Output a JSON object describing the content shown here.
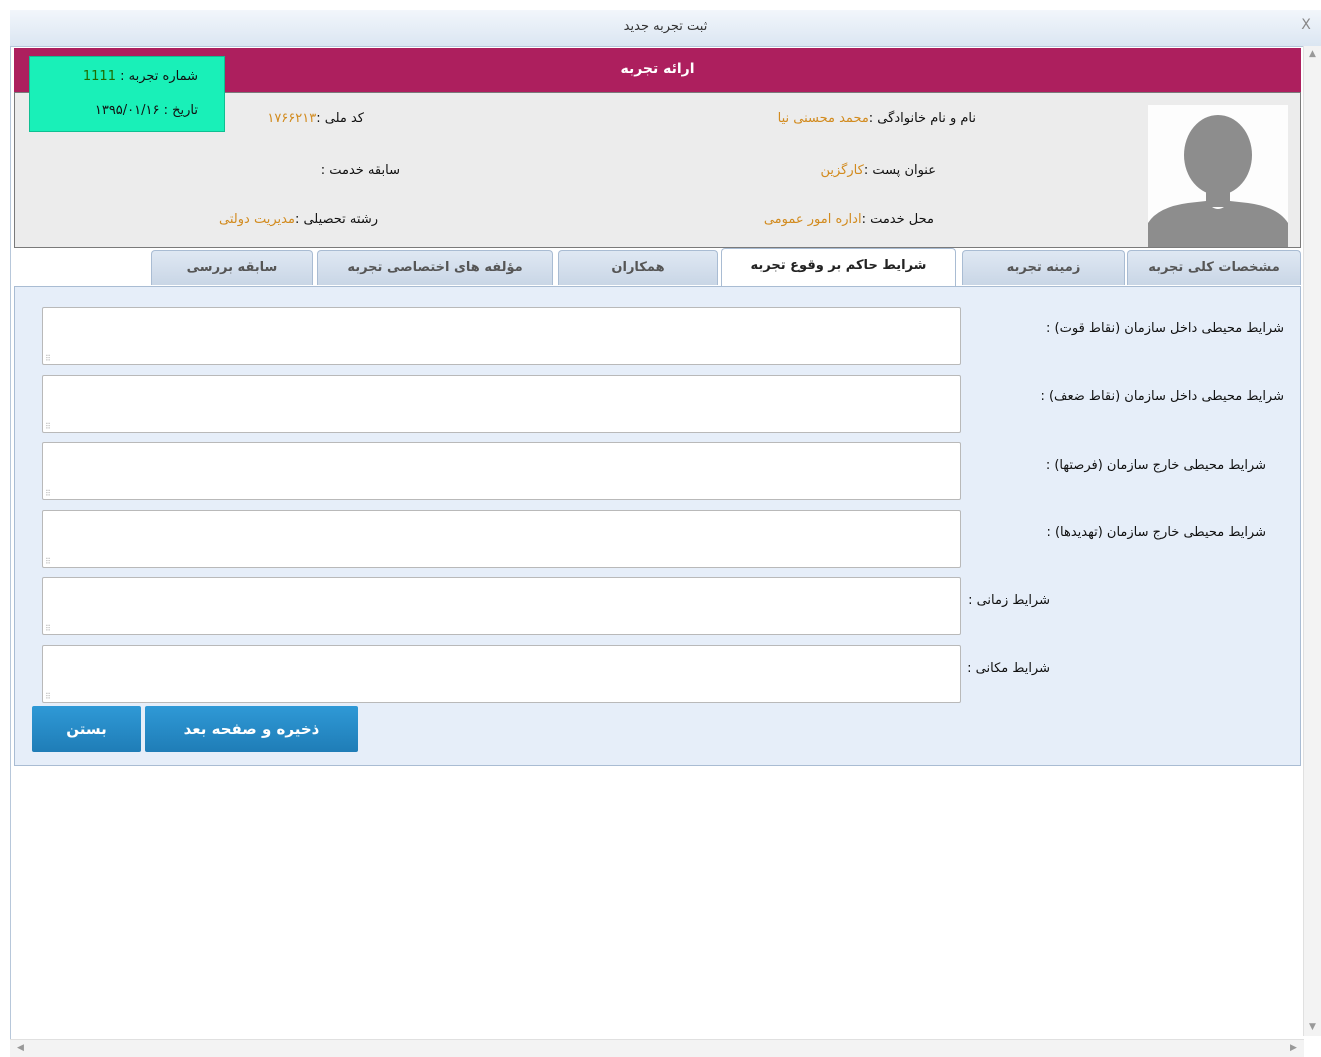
{
  "window": {
    "title": "ثبت تجربه جدید",
    "close_glyph": "X"
  },
  "header": {
    "title": "ارائه تجربه"
  },
  "badge": {
    "experience_number_label": "شماره تجربه : ",
    "experience_number": "1111",
    "date_label": "تاریخ : ",
    "date": "۱۳۹۵/۰۱/۱۶"
  },
  "info": {
    "name_label": "نام و نام خانوادگی :",
    "name_value": "محمد محسنی نیا",
    "national_code_label": "کد ملی :",
    "national_code_value": "۱۷۶۶۲۱۳",
    "position_label": "عنوان پست :",
    "position_value": "کارگزین",
    "service_history_label": "سابقه خدمت :",
    "service_history_value": "",
    "workplace_label": "محل خدمت :",
    "workplace_value": "اداره امور عمومی",
    "field_of_study_label": "رشته تحصیلی :",
    "field_of_study_value": "مدیریت دولتی",
    "avatar_icon": "user-silhouette-icon"
  },
  "tabs": [
    {
      "label": "مشخصات کلی تجربه",
      "active": false
    },
    {
      "label": "زمینه تجربه",
      "active": false
    },
    {
      "label": "شرایط حاکم بر وقوع تجربه",
      "active": true
    },
    {
      "label": "همکاران",
      "active": false
    },
    {
      "label": "مؤلفه های اختصاصی تجربه",
      "active": false
    },
    {
      "label": "سابقه بررسی",
      "active": false
    }
  ],
  "form": {
    "fields": [
      {
        "label": "شرایط محیطی داخل سازمان (نقاط قوت) :",
        "value": ""
      },
      {
        "label": "شرایط محیطی داخل سازمان (نقاط ضعف) :",
        "value": ""
      },
      {
        "label": "شرایط محیطی خارج سازمان (فرصتها) :",
        "value": ""
      },
      {
        "label": "شرایط محیطی خارج سازمان (تهدیدها) :",
        "value": ""
      },
      {
        "label": "شرایط زمانی :",
        "value": ""
      },
      {
        "label": "شرایط مکانی :",
        "value": ""
      }
    ]
  },
  "buttons": {
    "save_next": "ذخیره و صفحه بعد",
    "close": "بستن"
  },
  "colors": {
    "header_bar": "#ad1f5e",
    "badge": "#19f0b8",
    "value_text": "#d28b1f",
    "content_bg": "#e6eef9",
    "button": "#1f7db7"
  }
}
